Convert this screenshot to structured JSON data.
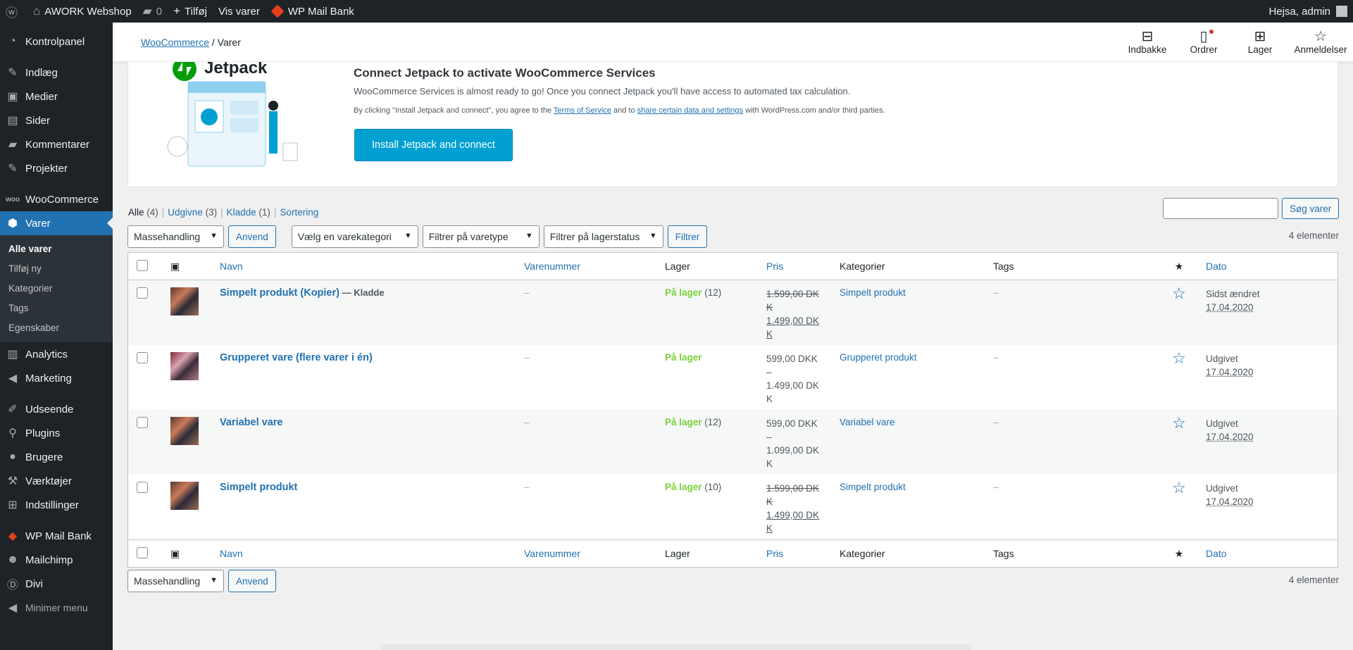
{
  "adminbar": {
    "site_name": "AWORK Webshop",
    "comments_count": "0",
    "add_new": "Tilføj",
    "view": "Vis varer",
    "mail_bank": "WP Mail Bank",
    "greeting": "Hejsa, admin"
  },
  "sidebar": {
    "items": [
      {
        "label": "Kontrolpanel",
        "icon": "dashboard-icon"
      },
      {
        "label": "Indlæg",
        "icon": "pin-icon"
      },
      {
        "label": "Medier",
        "icon": "media-icon"
      },
      {
        "label": "Sider",
        "icon": "page-icon"
      },
      {
        "label": "Kommentarer",
        "icon": "comment-icon"
      },
      {
        "label": "Projekter",
        "icon": "pin-icon"
      },
      {
        "label": "WooCommerce",
        "icon": "woo-icon"
      },
      {
        "label": "Varer",
        "icon": "box-icon"
      },
      {
        "label": "Analytics",
        "icon": "bar-chart-icon"
      },
      {
        "label": "Marketing",
        "icon": "megaphone-icon"
      },
      {
        "label": "Udseende",
        "icon": "brush-icon"
      },
      {
        "label": "Plugins",
        "icon": "plug-icon"
      },
      {
        "label": "Brugere",
        "icon": "user-icon"
      },
      {
        "label": "Værktøjer",
        "icon": "wrench-icon"
      },
      {
        "label": "Indstillinger",
        "icon": "settings-icon"
      },
      {
        "label": "WP Mail Bank",
        "icon": "mail-bank-icon"
      },
      {
        "label": "Mailchimp",
        "icon": "mailchimp-icon"
      },
      {
        "label": "Divi",
        "icon": "divi-icon"
      }
    ],
    "submenu": [
      "Alle varer",
      "Tilføj ny",
      "Kategorier",
      "Tags",
      "Egenskaber"
    ],
    "collapse": "Minimer menu"
  },
  "header": {
    "breadcrumb_link": "WooCommerce",
    "breadcrumb_sep": "/",
    "breadcrumb_current": "Varer",
    "activity": [
      {
        "label": "Indbakke",
        "icon": "inbox-icon"
      },
      {
        "label": "Ordrer",
        "icon": "orders-icon"
      },
      {
        "label": "Lager",
        "icon": "stock-icon"
      },
      {
        "label": "Anmeldelser",
        "icon": "star-icon"
      }
    ]
  },
  "banner": {
    "logo_text": "Jetpack",
    "title": "Connect Jetpack to activate WooCommerce Services",
    "subtitle": "WooCommerce Services is almost ready to go! Once you connect Jetpack you'll have access to automated tax calculation.",
    "legal_pre": "By clicking \"Install Jetpack and connect\", you agree to the ",
    "legal_tos": "Terms of Service",
    "legal_mid": " and to ",
    "legal_share": "share certain data and settings",
    "legal_post": " with WordPress.com and/or third parties.",
    "button": "Install Jetpack and connect"
  },
  "views": {
    "all": "Alle",
    "all_count": "(4)",
    "published": "Udgivne",
    "published_count": "(3)",
    "draft": "Kladde",
    "draft_count": "(1)",
    "sorting": "Sortering"
  },
  "search": {
    "button": "Søg varer"
  },
  "filters": {
    "bulk": "Massehandling",
    "apply": "Anvend",
    "category": "Vælg en varekategori",
    "type": "Filtrer på varetype",
    "stock": "Filtrer på lagerstatus",
    "filter_button": "Filtrer",
    "count": "4 elementer"
  },
  "table": {
    "columns": {
      "name": "Navn",
      "sku": "Varenummer",
      "stock": "Lager",
      "price": "Pris",
      "categories": "Kategorier",
      "tags": "Tags",
      "featured": "★",
      "date": "Dato"
    },
    "rows": [
      {
        "name": "Simpelt produkt (Kopier)",
        "state": " — Kladde",
        "sku": "–",
        "stock": "På lager",
        "stock_count": " (12)",
        "price_l1": "1.599,00 DK",
        "price_l2": "K",
        "price_l3": "1.499,00 DK",
        "price_l4": "K",
        "category": "Simpelt produkt",
        "tags": "–",
        "date_status": "Sidst ændret",
        "date": "17.04.2020"
      },
      {
        "name": "Grupperet vare (flere varer i én)",
        "state": "",
        "sku": "–",
        "stock": "På lager",
        "stock_count": "",
        "price_l1": "599,00 DKK",
        "price_l2": "–",
        "price_l3": "1.499,00 DK",
        "price_l4": "K",
        "category": "Grupperet produkt",
        "tags": "–",
        "date_status": "Udgivet",
        "date": "17.04.2020"
      },
      {
        "name": "Variabel vare",
        "state": "",
        "sku": "–",
        "stock": "På lager",
        "stock_count": " (12)",
        "price_l1": "599,00 DKK",
        "price_l2": "–",
        "price_l3": "1.099,00 DK",
        "price_l4": "K",
        "category": "Variabel vare",
        "tags": "–",
        "date_status": "Udgivet",
        "date": "17.04.2020"
      },
      {
        "name": "Simpelt produkt",
        "state": "",
        "sku": "–",
        "stock": "På lager",
        "stock_count": " (10)",
        "price_l1": "1.599,00 DK",
        "price_l2": "K",
        "price_l3": "1.499,00 DK",
        "price_l4": "K",
        "category": "Simpelt produkt",
        "tags": "–",
        "date_status": "Udgivet",
        "date": "17.04.2020"
      }
    ]
  },
  "colors": {
    "accent": "#2271b1",
    "adminbar": "#1d2327",
    "instock": "#7ad03a",
    "jetpack_button": "#00a0d2"
  }
}
